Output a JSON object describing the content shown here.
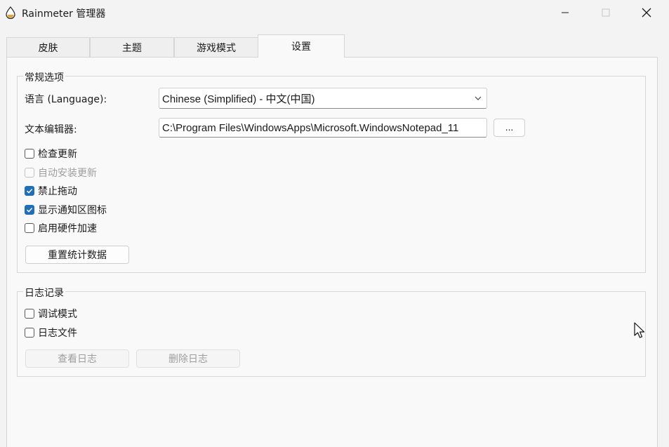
{
  "window": {
    "title": "Rainmeter 管理器",
    "icons": {
      "app": "water-drop-icon",
      "minimize": "minimize-icon",
      "maximize": "maximize-icon",
      "close": "close-icon"
    }
  },
  "tabs": [
    {
      "label": "皮肤",
      "active": false
    },
    {
      "label": "主题",
      "active": false
    },
    {
      "label": "游戏模式",
      "active": false
    },
    {
      "label": "设置",
      "active": true
    }
  ],
  "general": {
    "legend": "常规选项",
    "language_label": "语言 (Language):",
    "language_value": "Chinese (Simplified) - 中文(中国)",
    "editor_label": "文本编辑器:",
    "editor_value": "C:\\Program Files\\WindowsApps\\Microsoft.WindowsNotepad_11",
    "browse_label": "...",
    "checkboxes": [
      {
        "label": "检查更新",
        "checked": false,
        "enabled": true
      },
      {
        "label": "自动安装更新",
        "checked": false,
        "enabled": false
      },
      {
        "label": "禁止拖动",
        "checked": true,
        "enabled": true
      },
      {
        "label": "显示通知区图标",
        "checked": true,
        "enabled": true
      },
      {
        "label": "启用硬件加速",
        "checked": false,
        "enabled": true
      }
    ],
    "reset_label": "重置统计数据"
  },
  "logging": {
    "legend": "日志记录",
    "checkboxes": [
      {
        "label": "调试模式",
        "checked": false,
        "enabled": true
      },
      {
        "label": "日志文件",
        "checked": false,
        "enabled": true
      }
    ],
    "view_log_label": "查看日志",
    "delete_log_label": "删除日志"
  },
  "colors": {
    "accent": "#1f6fb8",
    "disabled_text": "#9e9e9e"
  }
}
